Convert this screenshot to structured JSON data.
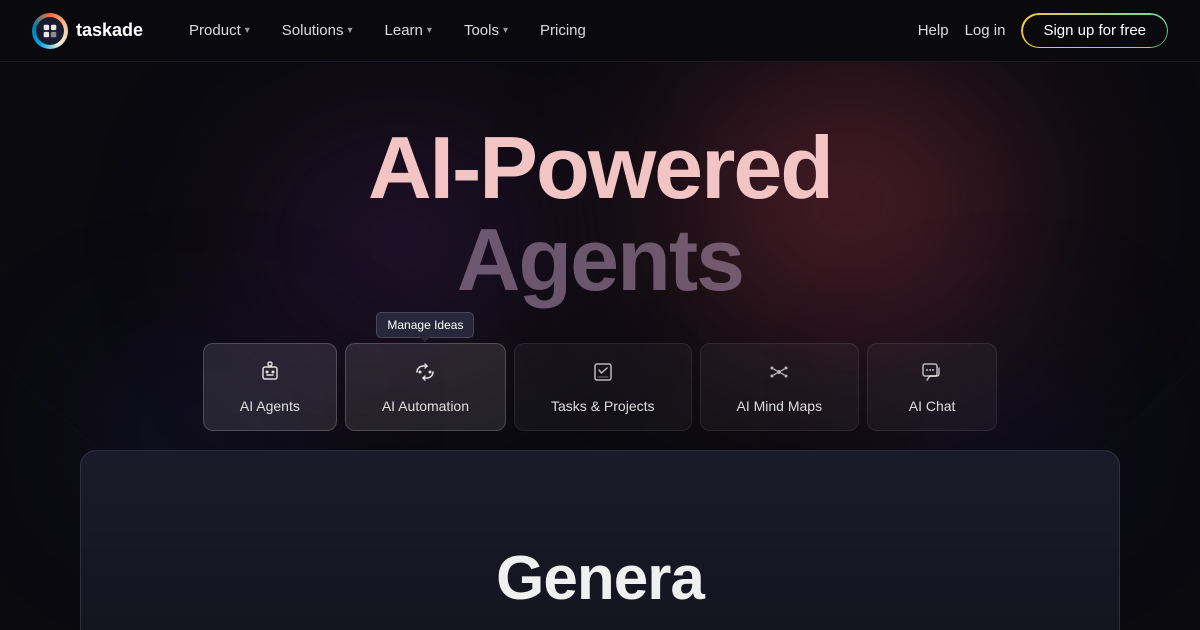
{
  "brand": {
    "logo_emoji": "🤖",
    "name": "taskade"
  },
  "nav": {
    "items": [
      {
        "label": "Product",
        "has_dropdown": true
      },
      {
        "label": "Solutions",
        "has_dropdown": true
      },
      {
        "label": "Learn",
        "has_dropdown": true
      },
      {
        "label": "Tools",
        "has_dropdown": true
      },
      {
        "label": "Pricing",
        "has_dropdown": false
      }
    ],
    "help": "Help",
    "login": "Log in",
    "signup": "Sign up for free"
  },
  "hero": {
    "line1": "AI-Powered",
    "line2": "Agents"
  },
  "feature_tabs": [
    {
      "id": "ai-agents",
      "label": "AI Agents",
      "icon": "🤖",
      "active": true
    },
    {
      "id": "ai-automation",
      "label": "AI Automation",
      "icon": "🔄",
      "active": true,
      "tooltip": "Manage Ideas"
    },
    {
      "id": "tasks-projects",
      "label": "Tasks & Projects",
      "icon": "📋",
      "active": false
    },
    {
      "id": "ai-mind-maps",
      "label": "AI Mind Maps",
      "icon": "🔀",
      "active": false
    },
    {
      "id": "ai-chat",
      "label": "AI Chat",
      "icon": "💬",
      "active": false
    }
  ],
  "bottom_card": {
    "title": "Genera"
  }
}
